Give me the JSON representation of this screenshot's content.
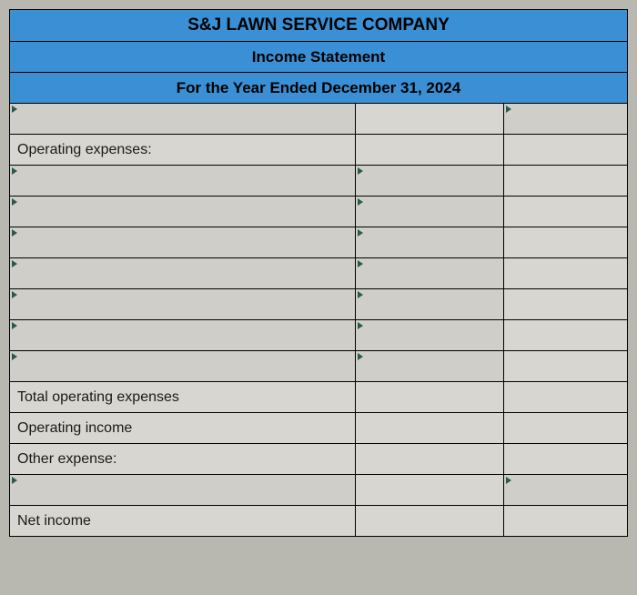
{
  "header": {
    "company": "S&J LAWN SERVICE COMPANY",
    "title": "Income Statement",
    "period": "For the Year Ended December 31, 2024"
  },
  "rows": {
    "operating_expenses_label": "Operating expenses:",
    "total_operating_expenses": "Total operating expenses",
    "operating_income": "Operating income",
    "other_expense": "Other expense:",
    "net_income": "Net income"
  }
}
